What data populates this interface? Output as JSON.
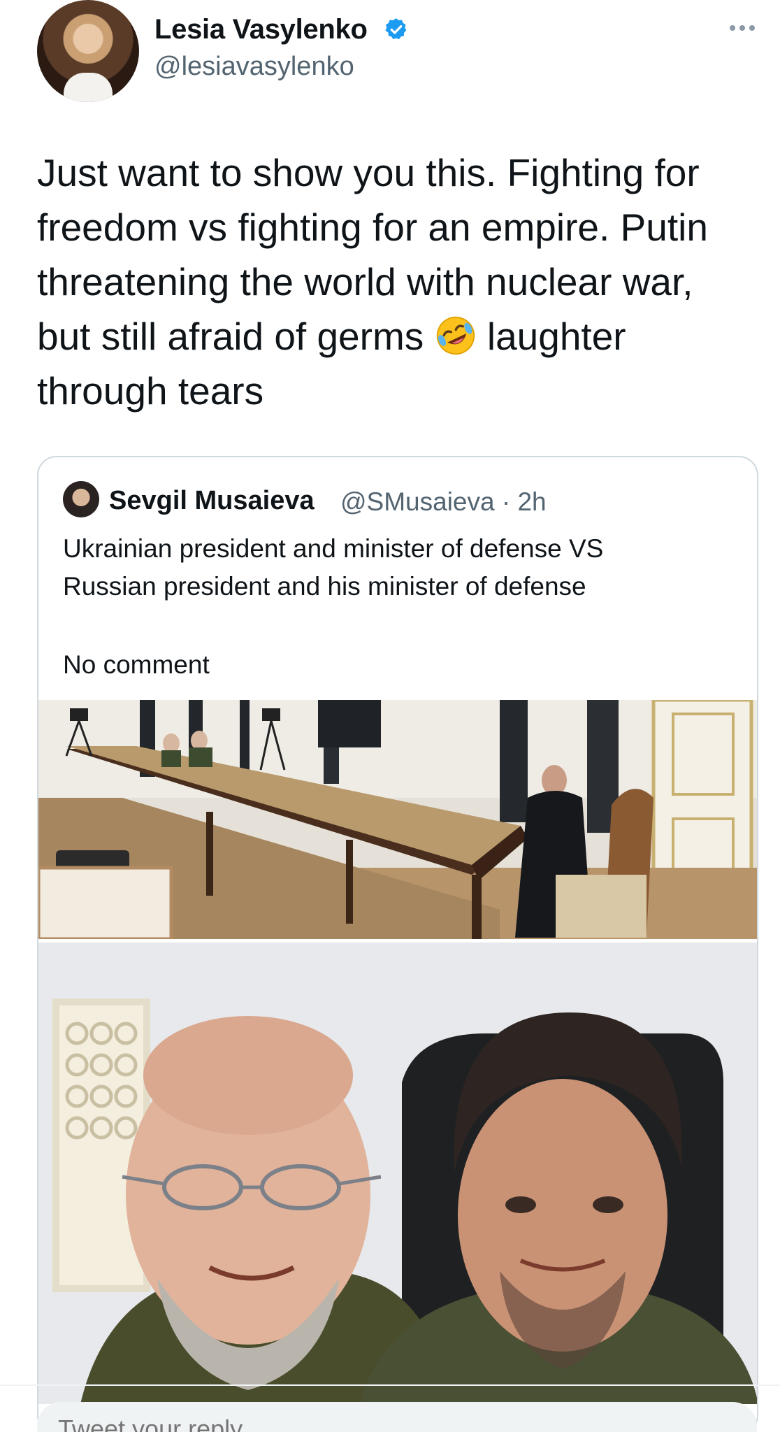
{
  "tweet": {
    "author_name": "Lesia Vasylenko",
    "author_handle": "@lesiavasylenko",
    "text_before_emoji": "Just want to show you this. Fighting for\nfreedom vs fighting for an empire. Putin\nthreatening the world with nuclear war,\nbut still afraid of germs ",
    "emoji": "rolling-on-floor-laughing-icon",
    "text_after_emoji": " laughter\nthrough tears"
  },
  "quoted_tweet": {
    "author_name": "Sevgil Musaieva",
    "author_handle": "@SMusaieva · 2h",
    "text": "Ukrainian president and minister of defense VS\nRussian president and his minister of defense",
    "text2": "No comment"
  },
  "reply": {
    "placeholder": "Tweet your reply"
  },
  "colors": {
    "verified": "#1d9bf0",
    "secondary_text": "#536471",
    "border": "#cfd9de"
  }
}
